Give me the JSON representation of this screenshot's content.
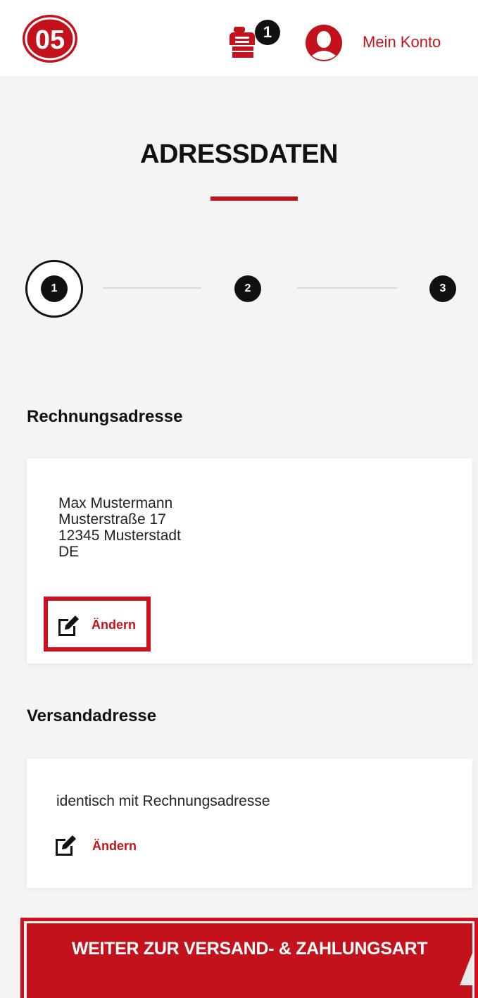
{
  "header": {
    "logo_text": "05",
    "cart_count": "1",
    "account_label": "Mein Konto"
  },
  "page": {
    "title": "ADRESSDATEN"
  },
  "stepper": {
    "steps": [
      "1",
      "2",
      "3"
    ],
    "active_step": 1
  },
  "billing": {
    "heading": "Rechnungsadresse",
    "address_lines": [
      "Max Mustermann",
      "Musterstraße 17",
      "12345 Musterstadt",
      "DE"
    ],
    "edit_label": "Ändern"
  },
  "shipping": {
    "heading": "Versandadresse",
    "note": "identisch mit Rechnungsadresse",
    "edit_label": "Ändern"
  },
  "cta": {
    "label": "WEITER ZUR VERSAND- & ZAHLUNGSART"
  },
  "colors": {
    "brand_red": "#c3121c",
    "highlight_red": "#d0101c",
    "background": "#f4f4f4",
    "dark": "#111111"
  }
}
